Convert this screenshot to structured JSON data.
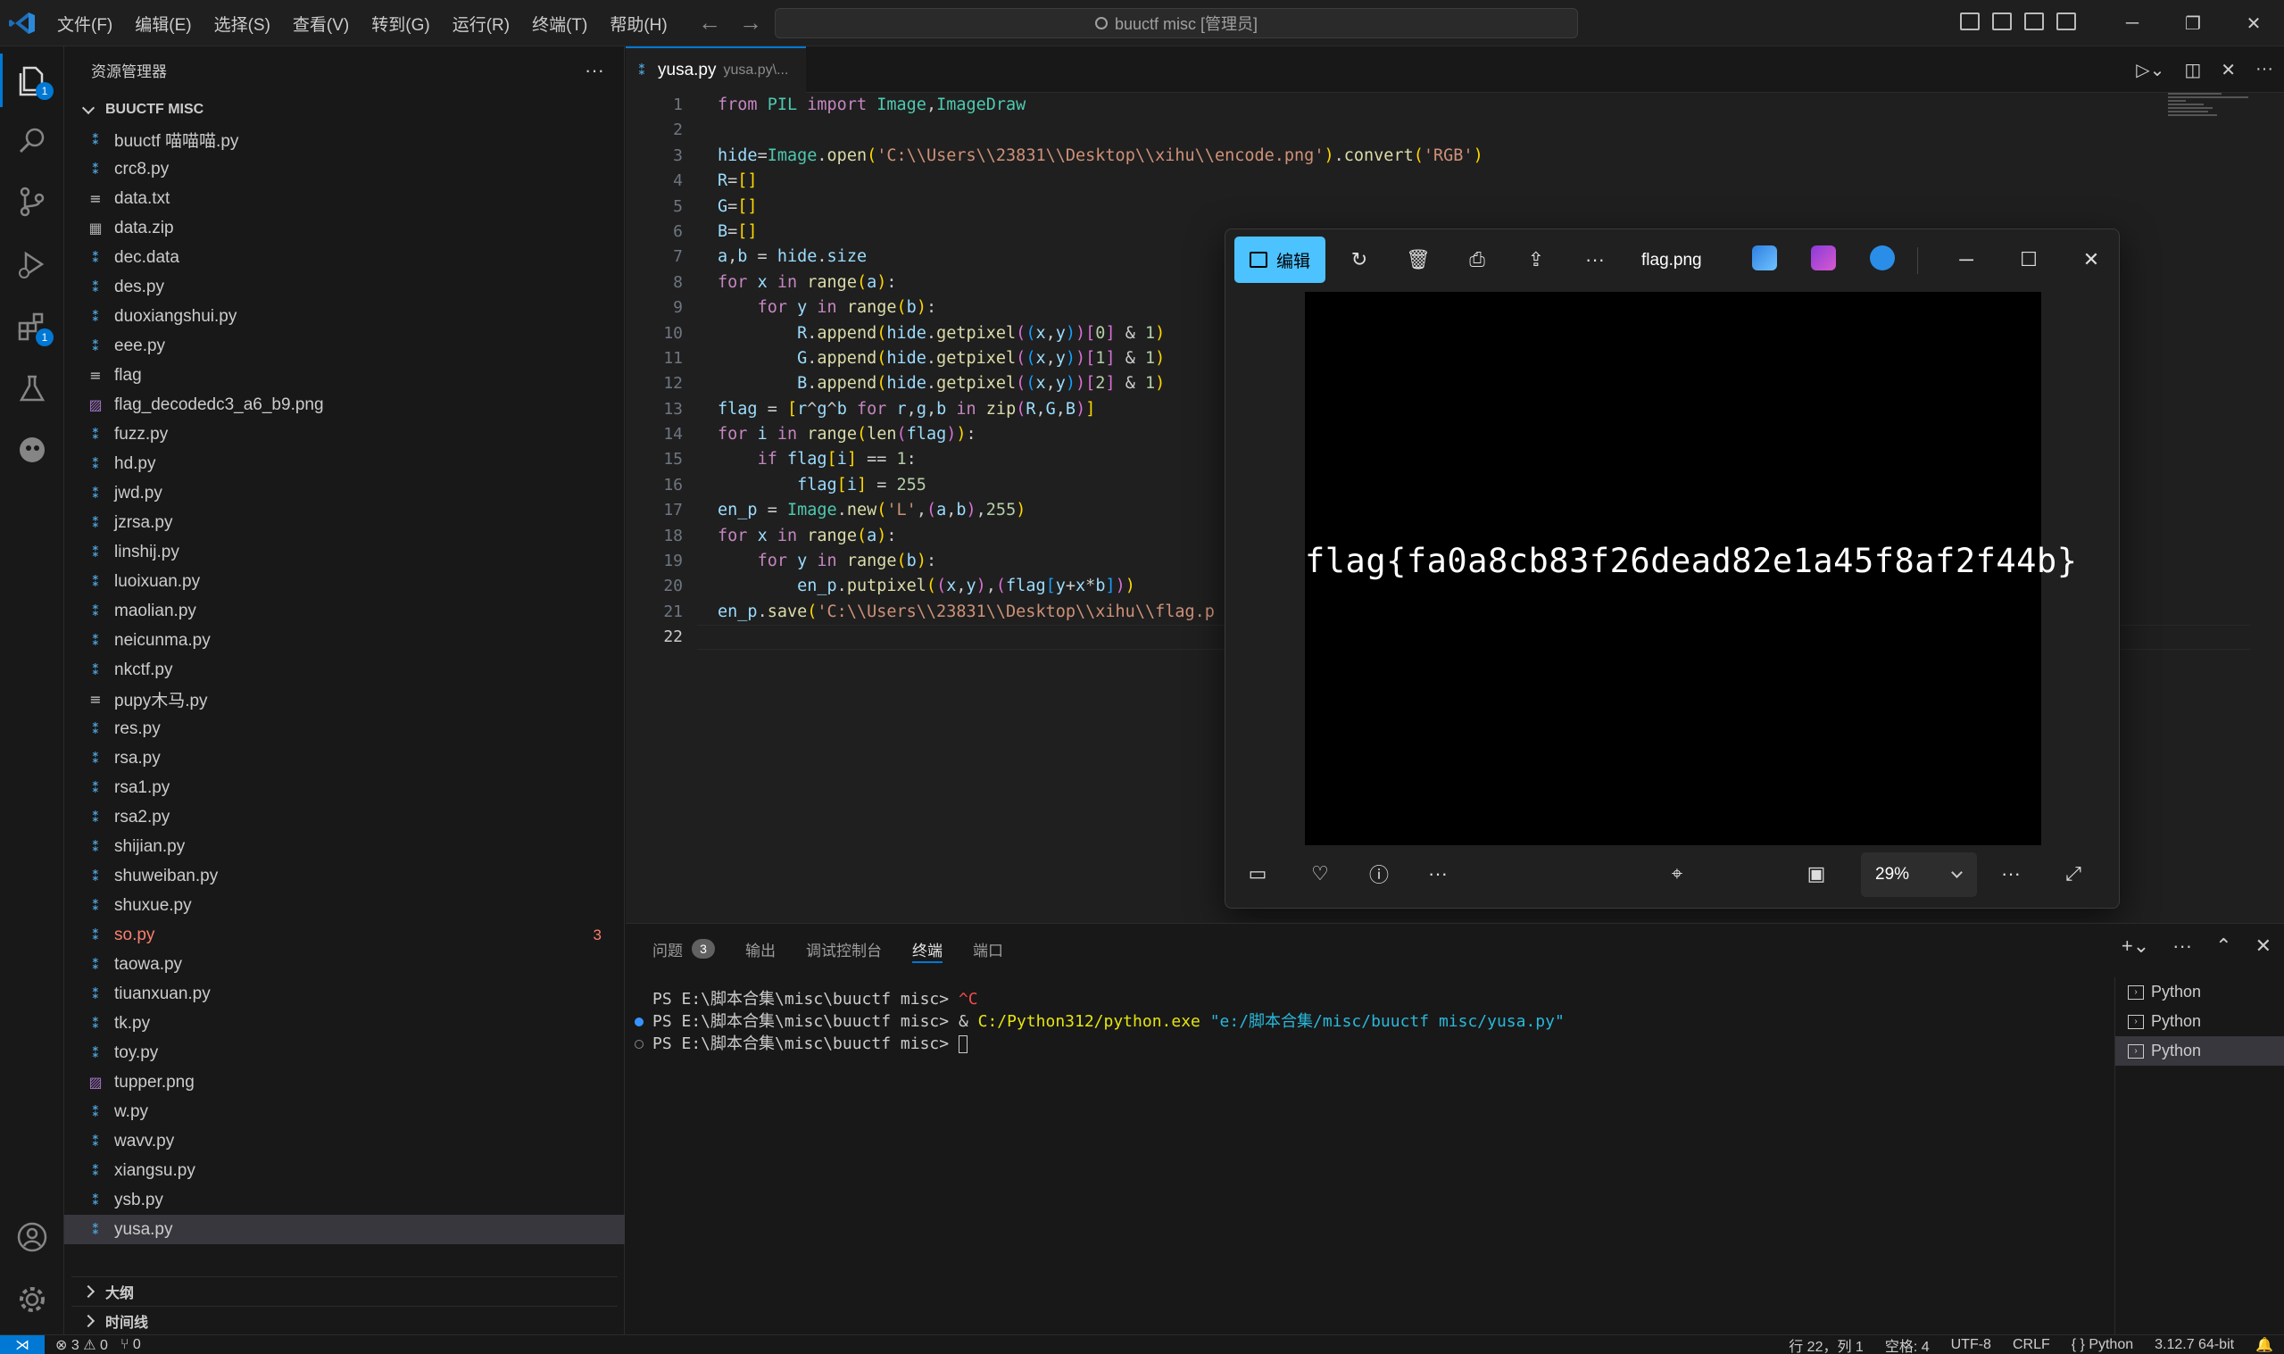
{
  "titlebar": {
    "menu": [
      "文件(F)",
      "编辑(E)",
      "选择(S)",
      "查看(V)",
      "转到(G)",
      "运行(R)",
      "终端(T)",
      "帮助(H)"
    ],
    "search_text": "buuctf misc [管理员]"
  },
  "activity": {
    "explorer_badge": "1",
    "extensions_badge": "1"
  },
  "sidebar": {
    "title": "资源管理器",
    "folder": "BUUCTF MISC",
    "files": [
      {
        "name": "buuctf 喵喵喵.py",
        "type": "py"
      },
      {
        "name": "crc8.py",
        "type": "py"
      },
      {
        "name": "data.txt",
        "type": "txt"
      },
      {
        "name": "data.zip",
        "type": "zip"
      },
      {
        "name": "dec.data",
        "type": "py"
      },
      {
        "name": "des.py",
        "type": "py"
      },
      {
        "name": "duoxiangshui.py",
        "type": "py"
      },
      {
        "name": "eee.py",
        "type": "py"
      },
      {
        "name": "flag",
        "type": "txt"
      },
      {
        "name": "flag_decodedc3_a6_b9.png",
        "type": "img"
      },
      {
        "name": "fuzz.py",
        "type": "py"
      },
      {
        "name": "hd.py",
        "type": "py"
      },
      {
        "name": "jwd.py",
        "type": "py"
      },
      {
        "name": "jzrsa.py",
        "type": "py"
      },
      {
        "name": "linshij.py",
        "type": "py"
      },
      {
        "name": "luoixuan.py",
        "type": "py"
      },
      {
        "name": "maolian.py",
        "type": "py"
      },
      {
        "name": "neicunma.py",
        "type": "py"
      },
      {
        "name": "nkctf.py",
        "type": "py"
      },
      {
        "name": "pupy木马.py",
        "type": "txt"
      },
      {
        "name": "res.py",
        "type": "py"
      },
      {
        "name": "rsa.py",
        "type": "py"
      },
      {
        "name": "rsa1.py",
        "type": "py"
      },
      {
        "name": "rsa2.py",
        "type": "py"
      },
      {
        "name": "shijian.py",
        "type": "py"
      },
      {
        "name": "shuweiban.py",
        "type": "py"
      },
      {
        "name": "shuxue.py",
        "type": "py"
      },
      {
        "name": "so.py",
        "type": "py",
        "error": true,
        "count": "3"
      },
      {
        "name": "taowa.py",
        "type": "py"
      },
      {
        "name": "tiuanxuan.py",
        "type": "py"
      },
      {
        "name": "tk.py",
        "type": "py"
      },
      {
        "name": "toy.py",
        "type": "py"
      },
      {
        "name": "tupper.png",
        "type": "img"
      },
      {
        "name": "w.py",
        "type": "py"
      },
      {
        "name": "wavv.py",
        "type": "py"
      },
      {
        "name": "xiangsu.py",
        "type": "py"
      },
      {
        "name": "ysb.py",
        "type": "py"
      },
      {
        "name": "yusa.py",
        "type": "py",
        "selected": true
      }
    ],
    "outline_label": "大纲",
    "timeline_label": "时间线"
  },
  "editor": {
    "tab_name": "yusa.py",
    "tab_path": "yusa.py\\...",
    "current_line": 22,
    "lines": [
      "from PIL import Image,ImageDraw",
      "",
      "hide=Image.open('C:\\\\Users\\\\23831\\\\Desktop\\\\xihu\\\\encode.png').convert('RGB')",
      "R=[]",
      "G=[]",
      "B=[]",
      "a,b = hide.size",
      "for x in range(a):",
      "    for y in range(b):",
      "        R.append(hide.getpixel((x,y))[0] & 1)",
      "        G.append(hide.getpixel((x,y))[1] & 1)",
      "        B.append(hide.getpixel((x,y))[2] & 1)",
      "flag = [r^g^b for r,g,b in zip(R,G,B)]",
      "for i in range(len(flag)):",
      "    if flag[i] == 1:",
      "        flag[i] = 255",
      "en_p = Image.new('L',(a,b),255)",
      "for x in range(a):",
      "    for y in range(b):",
      "        en_p.putpixel((x,y),(flag[y+x*b]))",
      "en_p.save('C:\\\\Users\\\\23831\\\\Desktop\\\\xihu\\\\flag.p",
      ""
    ]
  },
  "photos": {
    "edit_label": "编辑",
    "filename": "flag.png",
    "image_text": "flag{fa0a8cb83f26dead82e1a45f8af2f44b}",
    "zoom": "29%"
  },
  "panel": {
    "tabs": [
      {
        "label": "问题",
        "badge": "3"
      },
      {
        "label": "输出"
      },
      {
        "label": "调试控制台"
      },
      {
        "label": "终端",
        "active": true
      },
      {
        "label": "端口"
      }
    ],
    "terminal": {
      "l1_prompt": "PS E:\\脚本合集\\misc\\buuctf misc> ",
      "l1_cmd": "^C",
      "l2_prompt": "PS E:\\脚本合集\\misc\\buuctf misc> ",
      "l2_amp": "& ",
      "l2_exe": "C:/Python312/python.exe",
      "l2_arg": " \"e:/脚本合集/misc/buuctf misc/yusa.py\"",
      "l3_prompt": "PS E:\\脚本合集\\misc\\buuctf misc> "
    },
    "terminal_list": [
      "Python",
      "Python",
      "Python"
    ]
  },
  "statusbar": {
    "problems": "⊗ 3 ⚠ 0",
    "ports": "⑂ 0",
    "position": "行 22，列 1",
    "spaces": "空格: 4",
    "encoding": "UTF-8",
    "eol": "CRLF",
    "language": "{ } Python",
    "interpreter": "3.12.7 64-bit"
  }
}
